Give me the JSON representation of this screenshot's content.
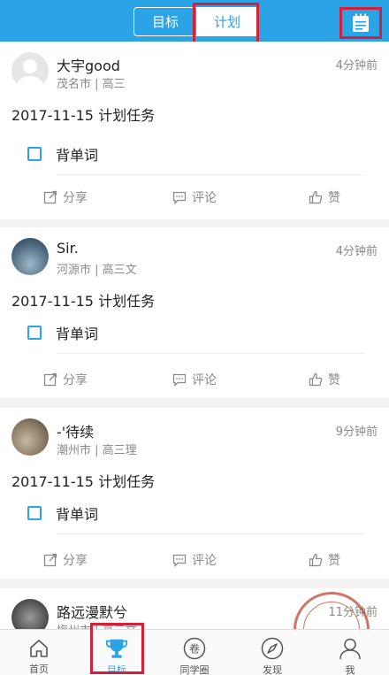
{
  "header": {
    "tabs": [
      {
        "label": "目标",
        "active": false
      },
      {
        "label": "计划",
        "active": true
      }
    ],
    "right_icon": "plan-notebook-icon",
    "accent": "#2aa4e6",
    "highlight": "#d6203a"
  },
  "posts": [
    {
      "name": "大宇good",
      "location": "茂名市 | 高三",
      "time": "4分钟前",
      "date_title": "2017-11-15 计划任务",
      "task": "背单词",
      "actions": {
        "share": "分享",
        "comment": "评论",
        "like": "赞"
      }
    },
    {
      "name": "Sir.",
      "location": "河源市 | 高三文",
      "time": "4分钟前",
      "date_title": "2017-11-15 计划任务",
      "task": "背单词",
      "actions": {
        "share": "分享",
        "comment": "评论",
        "like": "赞"
      }
    },
    {
      "name": "-'待续",
      "location": "潮州市 | 高三理",
      "time": "9分钟前",
      "date_title": "2017-11-15 计划任务",
      "task": "背单词",
      "actions": {
        "share": "分享",
        "comment": "评论",
        "like": "赞"
      }
    },
    {
      "name": "路远漫默兮",
      "location": "梅州市 | 高三文",
      "time": "11分钟前"
    }
  ],
  "tabbar": {
    "items": [
      {
        "label": "首页",
        "icon": "home-icon",
        "active": false
      },
      {
        "label": "目标",
        "icon": "trophy-icon",
        "active": true
      },
      {
        "label": "同学圈",
        "icon": "classmates-circle-icon",
        "glyph": "卷",
        "active": false
      },
      {
        "label": "发现",
        "icon": "compass-icon",
        "active": false
      },
      {
        "label": "我",
        "icon": "person-icon",
        "active": false
      }
    ]
  }
}
